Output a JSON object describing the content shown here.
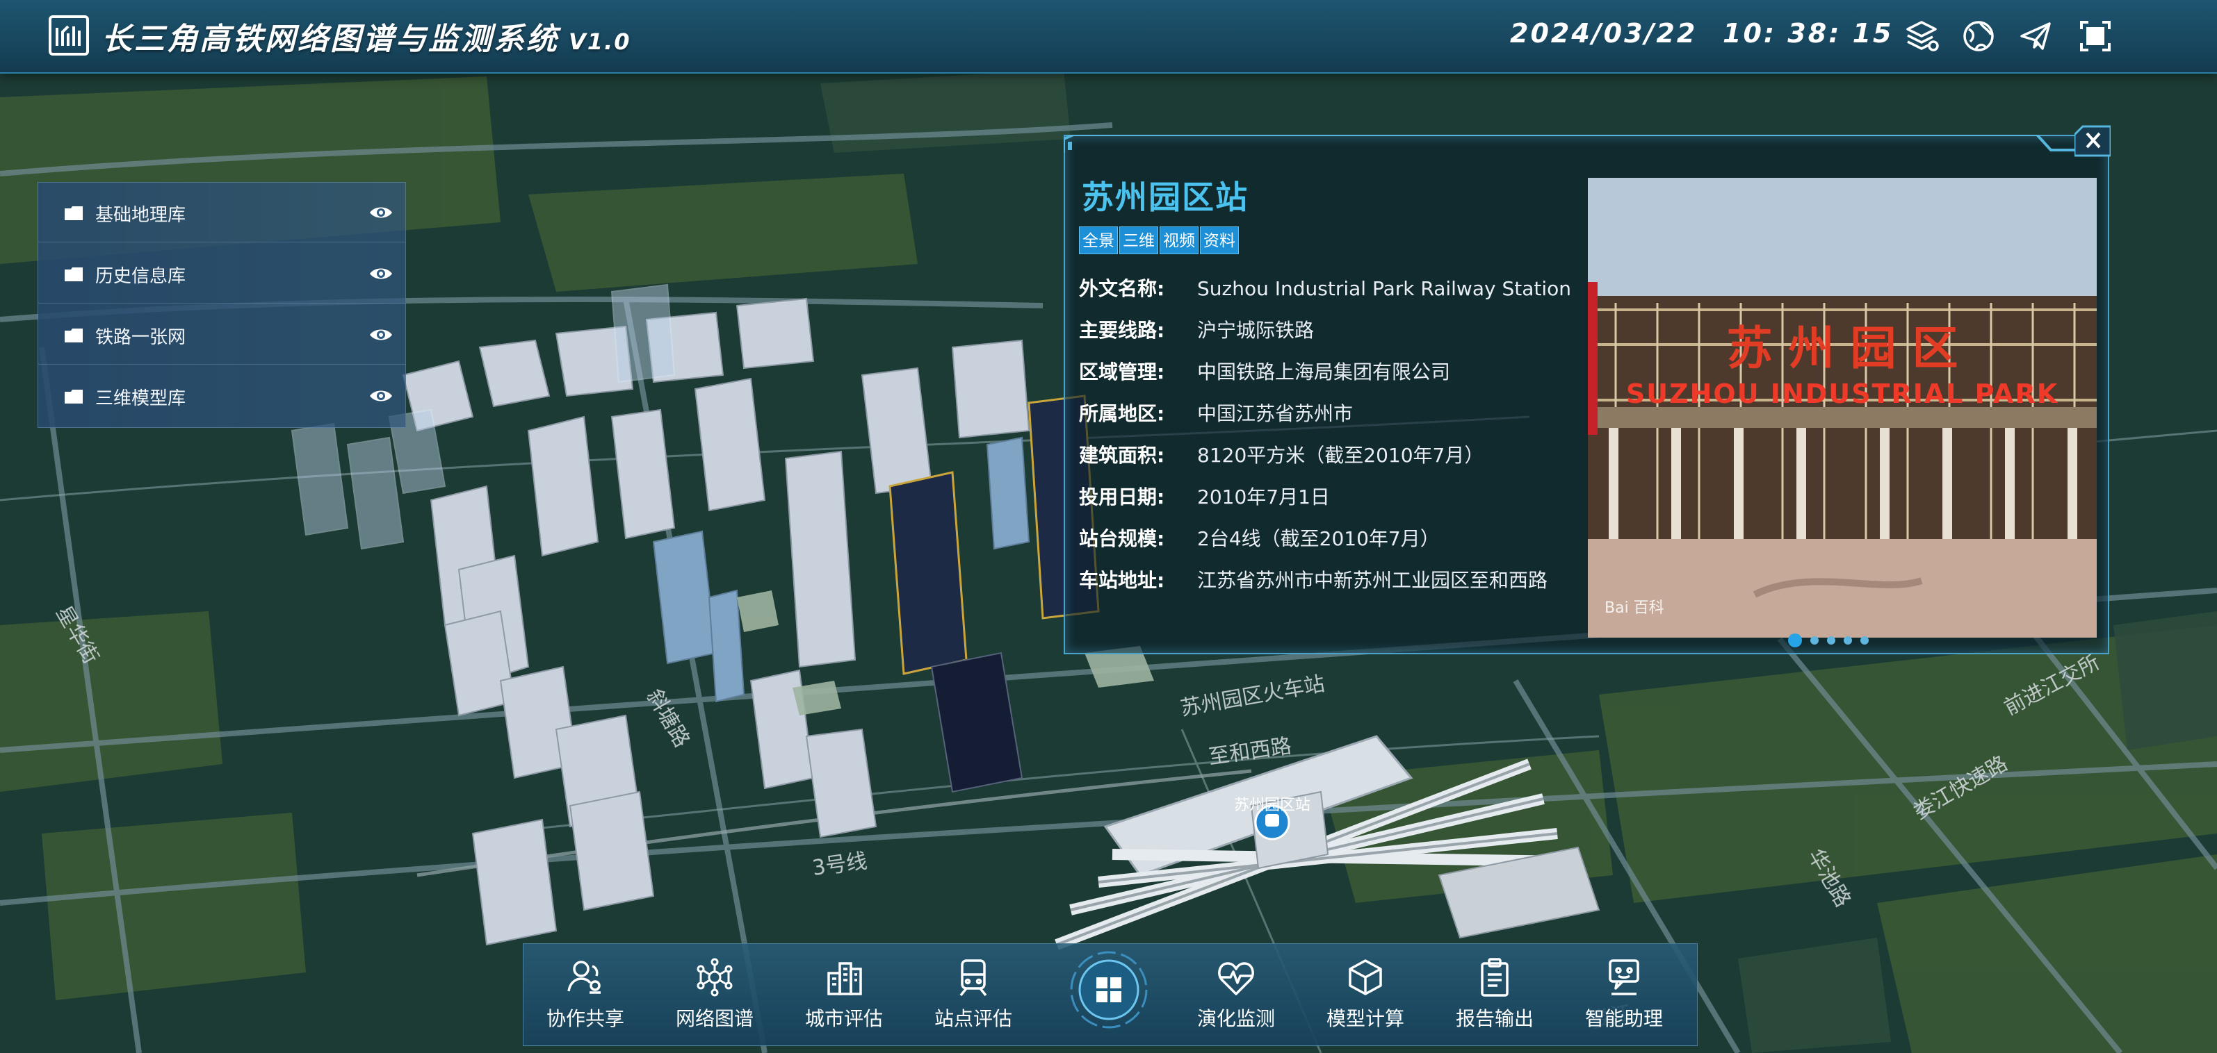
{
  "header": {
    "title": "长三角高铁网络图谱与监测系统",
    "version": "V1.0",
    "date": "2024/03/22",
    "time": "10: 38: 15",
    "icons": [
      "layers-icon",
      "globe-icon",
      "send-icon",
      "fullscreen-icon"
    ]
  },
  "layers": [
    {
      "label": "基础地理库",
      "icon": "folder-icon",
      "visibility_icon": "eye-icon"
    },
    {
      "label": "历史信息库",
      "icon": "folder-icon",
      "visibility_icon": "eye-icon"
    },
    {
      "label": "铁路一张网",
      "icon": "folder-icon",
      "visibility_icon": "eye-icon"
    },
    {
      "label": "三维模型库",
      "icon": "folder-icon",
      "visibility_icon": "eye-icon"
    }
  ],
  "map": {
    "station_marker": "苏州园区站",
    "street_labels": [
      "苏州园区火车站",
      "至和西路",
      "3号线",
      "前进江交所",
      "娄江快速路",
      "华池路",
      "星华街",
      "斜塘路",
      "娄江"
    ]
  },
  "popup": {
    "station_name": "苏州园区站",
    "tabs": [
      "全景",
      "三维",
      "视频",
      "资料"
    ],
    "rows": [
      {
        "label": "外文名称:",
        "value": "Suzhou Industrial Park Railway Station"
      },
      {
        "label": "主要线路:",
        "value": "沪宁城际铁路"
      },
      {
        "label": "区域管理:",
        "value": "中国铁路上海局集团有限公司"
      },
      {
        "label": "所属地区:",
        "value": "中国江苏省苏州市"
      },
      {
        "label": "建筑面积:",
        "value": "8120平方米（截至2010年7月）"
      },
      {
        "label": "投用日期:",
        "value": "2010年7月1日"
      },
      {
        "label": "站台规模:",
        "value": "2台4线（截至2010年7月）"
      },
      {
        "label": "车站地址:",
        "value": "江苏省苏州市中新苏州工业园区至和西路"
      }
    ],
    "photo": {
      "sign_cn": "苏 州 园 区",
      "sign_en": "SUZHOU INDUSTRIAL PARK",
      "watermark": "Bai 百科"
    },
    "carousel_count": 5,
    "carousel_active": 0
  },
  "toolbar": {
    "items_left": [
      {
        "label": "协作共享",
        "icon": "users-icon"
      },
      {
        "label": "网络图谱",
        "icon": "network-icon"
      },
      {
        "label": "城市评估",
        "icon": "buildings-icon"
      },
      {
        "label": "站点评估",
        "icon": "train-icon"
      }
    ],
    "center_icon": "grid-home-icon",
    "items_right": [
      {
        "label": "演化监测",
        "icon": "monitor-icon"
      },
      {
        "label": "模型计算",
        "icon": "cube-icon"
      },
      {
        "label": "报告输出",
        "icon": "report-icon"
      },
      {
        "label": "智能助理",
        "icon": "assistant-icon"
      }
    ]
  }
}
